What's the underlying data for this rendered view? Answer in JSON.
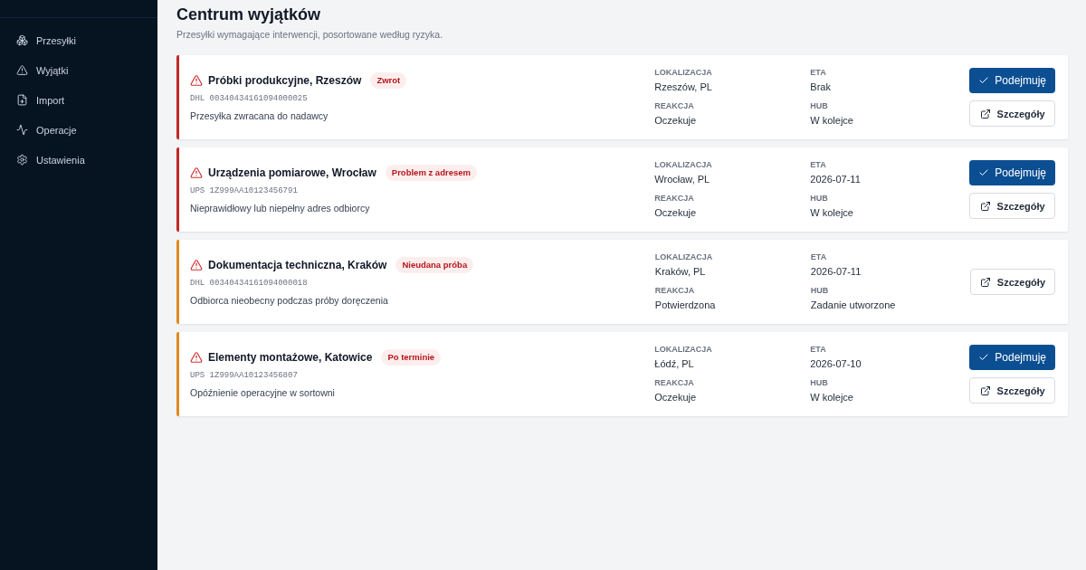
{
  "sidebar": {
    "items": [
      {
        "label": "Przesyłki"
      },
      {
        "label": "Wyjątki"
      },
      {
        "label": "Import"
      },
      {
        "label": "Operacje"
      },
      {
        "label": "Ustawienia"
      }
    ]
  },
  "page": {
    "title": "Centrum wyjątków",
    "subtitle": "Przesyłki wymagające interwencji, posortowane według ryzyka."
  },
  "cards": [
    {
      "color": "#c62828",
      "title": "Próbki produkcyjne, Rzeszów",
      "badge": "Zwrot",
      "tracking": "DHL 00340434161094000025",
      "description": "Przesyłka zwracana do nadawcy",
      "fields": [
        {
          "label": "LOKALIZACJA",
          "value": "Rzeszów, PL"
        },
        {
          "label": "ETA",
          "value": "Brak"
        },
        {
          "label": "REAKCJA",
          "value": "Oczekuje"
        },
        {
          "label": "HUB",
          "value": "W kolejce"
        }
      ],
      "actions": [
        {
          "kind": "primary",
          "label": "Podejmuję"
        },
        {
          "kind": "secondary",
          "label": "Szczegóły"
        }
      ]
    },
    {
      "color": "#c62828",
      "title": "Urządzenia pomiarowe, Wrocław",
      "badge": "Problem z adresem",
      "tracking": "UPS 1Z999AA10123456791",
      "description": "Nieprawidłowy lub niepełny adres odbiorcy",
      "fields": [
        {
          "label": "LOKALIZACJA",
          "value": "Wrocław, PL"
        },
        {
          "label": "ETA",
          "value": "2026-07-11"
        },
        {
          "label": "REAKCJA",
          "value": "Oczekuje"
        },
        {
          "label": "HUB",
          "value": "W kolejce"
        }
      ],
      "actions": [
        {
          "kind": "primary",
          "label": "Podejmuję"
        },
        {
          "kind": "secondary",
          "label": "Szczegóły"
        }
      ]
    },
    {
      "color": "#e08a1e",
      "title": "Dokumentacja techniczna, Kraków",
      "badge": "Nieudana próba",
      "tracking": "DHL 00340434161094000018",
      "description": "Odbiorca nieobecny podczas próby doręczenia",
      "fields": [
        {
          "label": "LOKALIZACJA",
          "value": "Kraków, PL"
        },
        {
          "label": "ETA",
          "value": "2026-07-11"
        },
        {
          "label": "REAKCJA",
          "value": "Potwierdzona"
        },
        {
          "label": "HUB",
          "value": "Zadanie utworzone"
        }
      ],
      "actions": [
        {
          "kind": "secondary",
          "label": "Szczegóły"
        }
      ]
    },
    {
      "color": "#e08a1e",
      "title": "Elementy montażowe, Katowice",
      "badge": "Po terminie",
      "tracking": "UPS 1Z999AA10123456807",
      "description": "Opóźnienie operacyjne w sortowni",
      "fields": [
        {
          "label": "LOKALIZACJA",
          "value": "Łódź, PL"
        },
        {
          "label": "ETA",
          "value": "2026-07-10"
        },
        {
          "label": "REAKCJA",
          "value": "Oczekuje"
        },
        {
          "label": "HUB",
          "value": "W kolejce"
        }
      ],
      "actions": [
        {
          "kind": "primary",
          "label": "Podejmuję"
        },
        {
          "kind": "secondary",
          "label": "Szczegóły"
        }
      ]
    }
  ]
}
